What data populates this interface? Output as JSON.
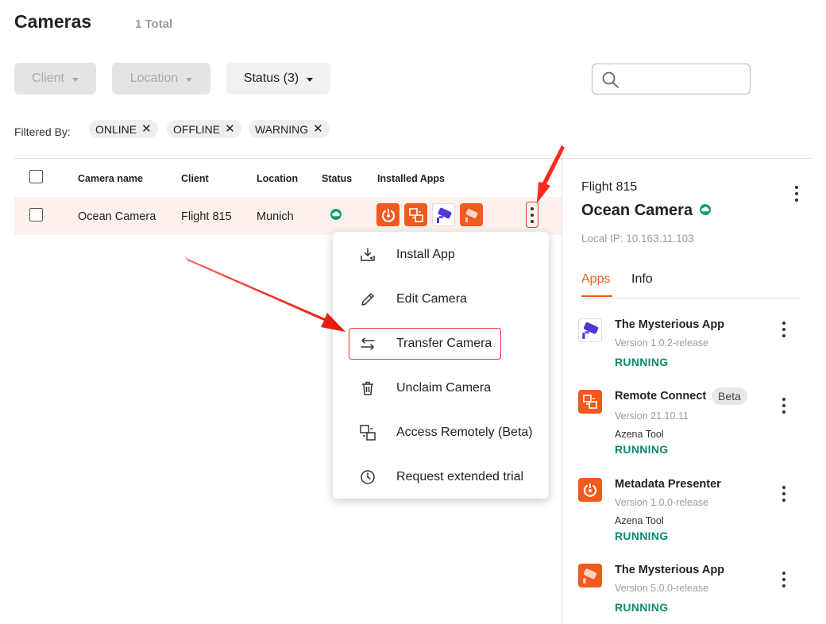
{
  "header": {
    "title": "Cameras",
    "total": "1 Total"
  },
  "filters": {
    "client_label": "Client",
    "location_label": "Location",
    "status_label": "Status (3)",
    "filtered_by_label": "Filtered By:",
    "chips": [
      "ONLINE",
      "OFFLINE",
      "WARNING"
    ]
  },
  "search": {
    "placeholder": ""
  },
  "table": {
    "headers": [
      "Camera name",
      "Client",
      "Location",
      "Status",
      "Installed Apps"
    ],
    "row": {
      "camera_name": "Ocean Camera",
      "client": "Flight 815",
      "location": "Munich",
      "status": "online"
    },
    "installed_app_icons": [
      "metadata-presenter-icon",
      "remote-connect-icon",
      "mysterious-app-icon",
      "mysterious-app-5-icon"
    ]
  },
  "context_menu": {
    "items": [
      {
        "label": "Install App",
        "icon": "install-icon"
      },
      {
        "label": "Edit Camera",
        "icon": "pencil-icon"
      },
      {
        "label": "Transfer Camera",
        "icon": "transfer-icon"
      },
      {
        "label": "Unclaim Camera",
        "icon": "trash-icon"
      },
      {
        "label": "Access Remotely (Beta)",
        "icon": "remote-access-icon"
      },
      {
        "label": "Request extended trial",
        "icon": "clock-icon"
      }
    ],
    "highlighted": "Transfer Camera"
  },
  "details": {
    "client": "Flight 815",
    "camera_name": "Ocean Camera",
    "local_ip": "Local IP: 10.163.11.103",
    "tabs": [
      "Apps",
      "Info"
    ],
    "active_tab": "Apps",
    "apps": [
      {
        "name": "The Mysterious App",
        "version": "Version 1.0.2-release",
        "tool": "",
        "status": "RUNNING",
        "badge": ""
      },
      {
        "name": "Remote Connect",
        "version": "Version 21.10.11",
        "tool": "Azena Tool",
        "status": "RUNNING",
        "badge": "Beta"
      },
      {
        "name": "Metadata Presenter",
        "version": "Version 1.0.0-release",
        "tool": "Azena Tool",
        "status": "RUNNING",
        "badge": ""
      },
      {
        "name": "The Mysterious App",
        "version": "Version 5.0.0-release",
        "tool": "",
        "status": "RUNNING",
        "badge": ""
      }
    ]
  },
  "colors": {
    "accent": "#f05a1e",
    "running": "#0f8a6c",
    "online": "#1a9e6e",
    "highlight": "#e53935",
    "row_selected": "#fdf1ec"
  }
}
